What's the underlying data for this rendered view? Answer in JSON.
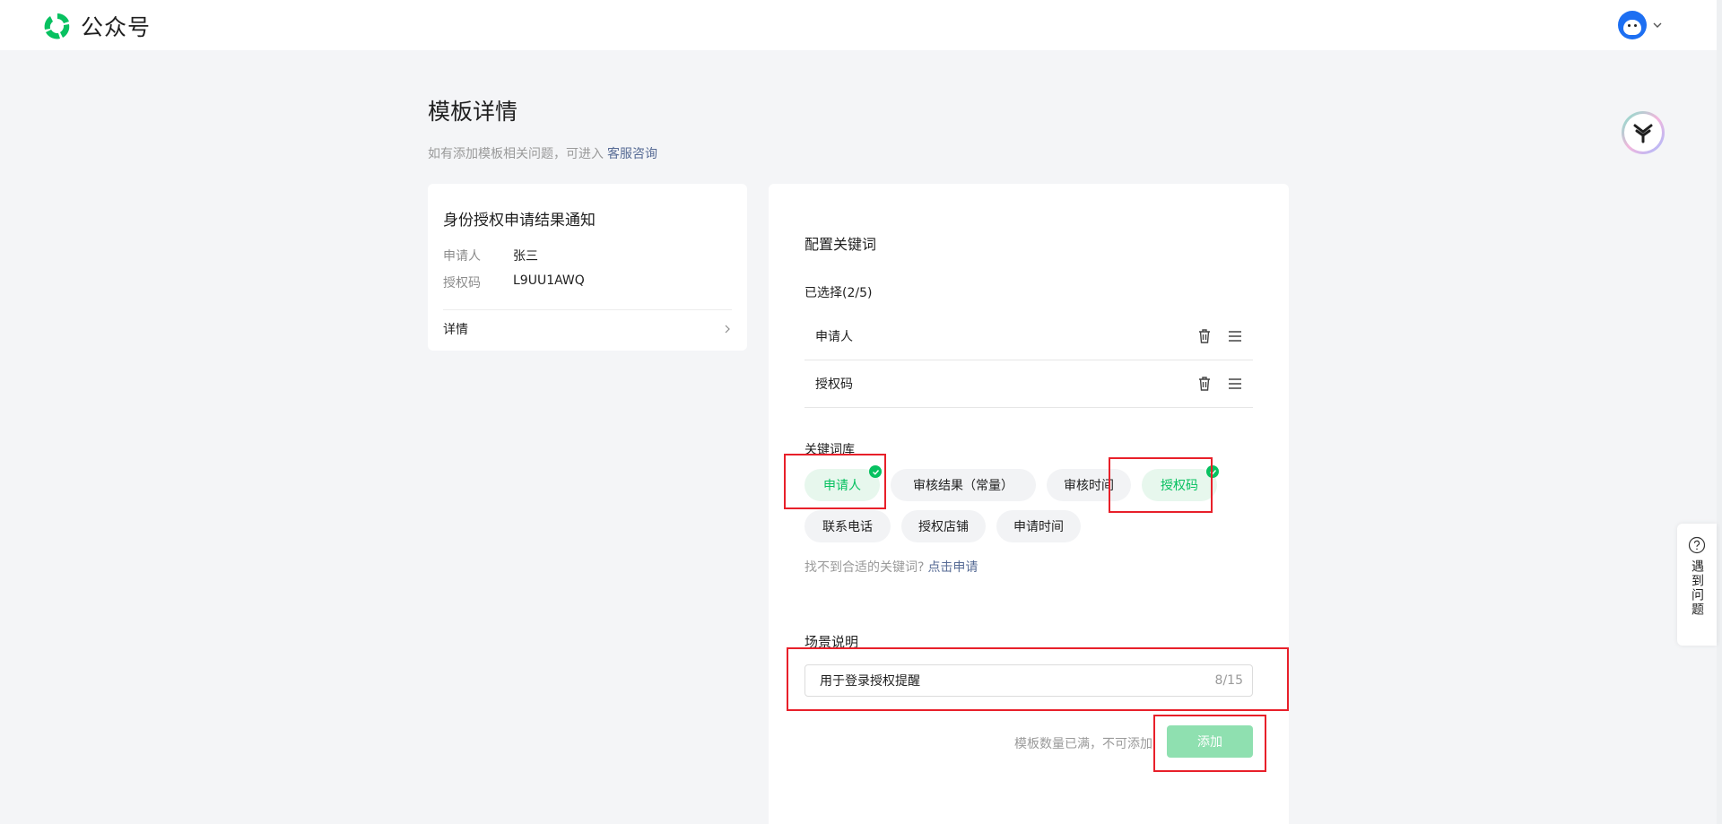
{
  "app": {
    "name": "公众号"
  },
  "page": {
    "title": "模板详情",
    "hint": "如有添加模板相关问题，可进入",
    "hint_link": "客服咨询"
  },
  "template_card": {
    "title": "身份授权申请结果通知",
    "fields": [
      {
        "key": "申请人",
        "value": "张三"
      },
      {
        "key": "授权码",
        "value": "L9UU1AWQ"
      }
    ],
    "detail_label": "详情"
  },
  "config": {
    "title": "配置关键词",
    "selected_label": "已选择(2/5)",
    "selected": [
      "申请人",
      "授权码"
    ],
    "library_label": "关键词库",
    "library": [
      {
        "label": "申请人",
        "selected": true
      },
      {
        "label": "审核结果（常量）",
        "selected": false
      },
      {
        "label": "审核时间",
        "selected": false
      },
      {
        "label": "授权码",
        "selected": true
      },
      {
        "label": "联系电话",
        "selected": false
      },
      {
        "label": "授权店铺",
        "selected": false
      },
      {
        "label": "申请时间",
        "selected": false
      }
    ],
    "missing_hint": "找不到合适的关键词?",
    "missing_link": "点击申请",
    "scene_label": "场景说明",
    "scene_value": "用于登录授权提醒",
    "scene_count": "8/15",
    "full_tip": "模板数量已满，不可添加",
    "add_label": "添加"
  },
  "help_tab": {
    "label": "遇到问题"
  },
  "icons": [
    "app-logo-icon",
    "avatar-icon",
    "chevron-down-icon",
    "assistant-icon",
    "chevron-right-icon",
    "trash-icon",
    "drag-handle-icon",
    "check-icon",
    "question-icon"
  ],
  "colors": {
    "accent": "#07c160",
    "link": "#576b95",
    "highlight": "#e8202a",
    "add_disabled": "#8fe0b0"
  }
}
